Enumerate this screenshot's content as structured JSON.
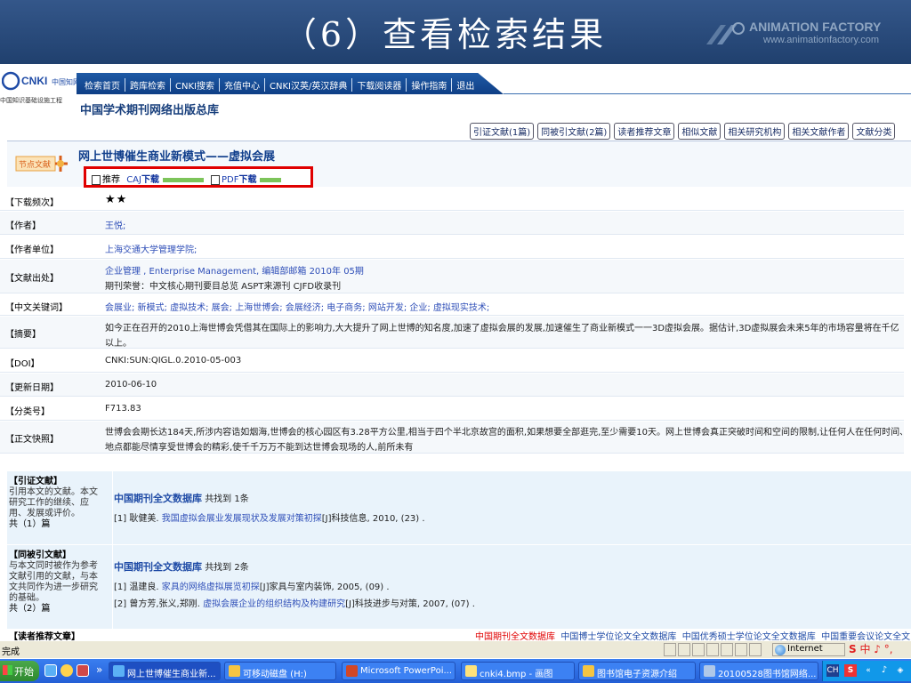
{
  "slide": {
    "title": "（6）查看检索结果",
    "logo_name": "ANIMATION FACTORY",
    "logo_url": "www.animationfactory.com"
  },
  "cnki": {
    "logo_text": "CNKI中国知网",
    "logo_sub": "中国知识基础设施工程",
    "nav": [
      "检索首页",
      "跨库检索",
      "CNKI搜索",
      "充值中心",
      "CNKI汉英/英汉辞典",
      "下载阅读器",
      "操作指南",
      "退出"
    ],
    "subtitle": "中国学术期刊网络出版总库"
  },
  "top_buttons": [
    "引证文献(1篇)",
    "同被引文献(2篇)",
    "读者推荐文章",
    "相似文献",
    "相关研究机构",
    "相关文献作者",
    "文献分类"
  ],
  "article": {
    "badge": "节点文献",
    "title": "网上世博催生商业新模式——虚拟会展",
    "recommend": "推荐",
    "caj_prefix": "CAJ",
    "caj_suffix": "下载",
    "pdf_prefix": "PDF",
    "pdf_suffix": "下载"
  },
  "info": {
    "download_freq": {
      "label": "【下载频次】",
      "value": "★★"
    },
    "author": {
      "label": "【作者】",
      "value": "王悦;"
    },
    "affiliation": {
      "label": "【作者单位】",
      "value": "上海交通大学管理学院;"
    },
    "source": {
      "label": "【文献出处】",
      "line1": "企业管理 , Enterprise Management, 编辑部邮箱 2010年 05期",
      "line2": "期刊荣誉：中文核心期刊要目总览 ASPT来源刊 CJFD收录刊"
    },
    "keywords": {
      "label": "【中文关键词】",
      "value": "会展业; 新模式; 虚拟技术; 展会; 上海世博会; 会展经济; 电子商务; 网站开发; 企业; 虚拟现实技术;"
    },
    "abstract": {
      "label": "【摘要】",
      "line1": "如今正在召开的2010上海世博会凭借其在国际上的影响力,大大提升了网上世博的知名度,加速了虚拟会展的发展,加速催生了商业新模式一一3D虚拟会展。据估计,3D虚拟展会未来5年的市场容量将在千亿",
      "line2": "以上。"
    },
    "doi": {
      "label": "【DOI】",
      "value": "CNKI:SUN:QIGL.0.2010-05-003"
    },
    "updated": {
      "label": "【更新日期】",
      "value": "2010-06-10"
    },
    "class": {
      "label": "【分类号】",
      "value": "F713.83"
    },
    "snapshot": {
      "label": "【正文快照】",
      "line1": "世博会会期长达184天,所涉内容诰如烟海,世博会的核心园区有3.28平方公里,相当于四个半北京故宫的面积,如果想要全部逛完,至少需要10天。网上世博会真正突破时间和空间的限制,让任何人在任何时间、",
      "line2": "地点都能尽情享受世博会的精彩,使千千万万不能到达世博会现场的人,前所未有"
    }
  },
  "citing": {
    "head": "【引证文献】",
    "desc": [
      "引用本文的文献。本文",
      "研究工作的继续、应",
      "用、发展或评价。"
    ],
    "count": "共（1）篇",
    "db": "中国期刊全文数据库",
    "found": "共找到 1条",
    "refs": [
      {
        "num": "[1]",
        "author": "耿健美.",
        "title": "我国虚拟会展业发展现状及发展对策初探",
        "type": "[J]",
        "pub": "科技信息, 2010, (23) ."
      }
    ]
  },
  "cocited": {
    "head": "【同被引文献】",
    "desc": [
      "与本文同时被作为参考",
      "文献引用的文献，与本",
      "文共同作为进一步研究",
      "的基础。"
    ],
    "count": "共（2）篇",
    "db": "中国期刊全文数据库",
    "found": "共找到 2条",
    "refs": [
      {
        "num": "[1]",
        "author": "温建良.",
        "title": "家具的网络虚拟展览初探",
        "type": "[J]",
        "pub": "家具与室内装饰, 2005, (09) ."
      },
      {
        "num": "[2]",
        "author": "曾方芳,张义,郑刚.",
        "title": "虚拟会展企业的组织结构及构建研究",
        "type": "[J]",
        "pub": "科技进步与对策, 2007, (07) ."
      }
    ]
  },
  "reader_rec": {
    "head": "【读者推荐文章】"
  },
  "bottom_links": [
    "中国期刊全文数据库",
    "中国博士学位论文全文数据库",
    "中国优秀硕士学位论文全文数据库",
    "中国重要会议论文全文"
  ],
  "status": {
    "text": "完成",
    "zone": "Internet",
    "ime": "中 ♪ °,"
  },
  "taskbar": {
    "start": "开始",
    "tasks": [
      "网上世博催生商业新...",
      "可移动磁盘 (H:)",
      "Microsoft PowerPoi...",
      "cnki4.bmp - 画图",
      "图书馆电子资源介绍",
      "20100528图书馆网络..."
    ],
    "tray_ch": "CH",
    "tray_s": "S",
    "tray_more": "«"
  },
  "colors": {
    "nav_blue": "#1f5aa5",
    "link_blue": "#2f4fb8",
    "highlight_red": "#e00000"
  }
}
